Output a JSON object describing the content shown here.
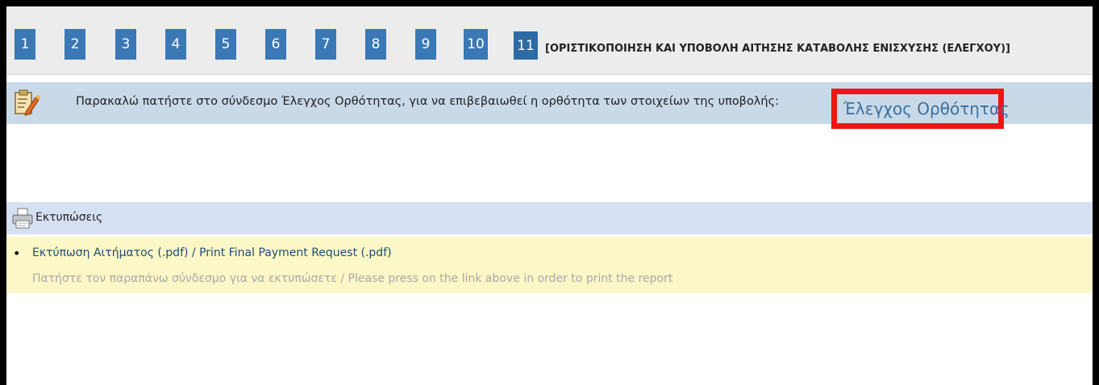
{
  "steps": [
    {
      "label": "1"
    },
    {
      "label": "2"
    },
    {
      "label": "3"
    },
    {
      "label": "4"
    },
    {
      "label": "5"
    },
    {
      "label": "6"
    },
    {
      "label": "7"
    },
    {
      "label": "8"
    },
    {
      "label": "9"
    },
    {
      "label": "10"
    },
    {
      "label": "11"
    }
  ],
  "step_title": "[ΟΡΙΣΤΙΚΟΠΟΙΗΣΗ ΚΑΙ ΥΠΟΒΟΛΗ ΑΙΤΗΣΗΣ ΚΑΤΑΒΟΛΗΣ ΕΝΙΣΧΥΣΗΣ (ΕΛΕΓΧΟΥ)]",
  "notice": {
    "icon": "clipboard-edit-icon",
    "text": "Παρακαλώ πατήστε στο σύνδεσμο Έλεγχος Ορθότητας, για να επιβεβαιωθεί η ορθότητα των στοιχείων της υποβολής:",
    "link_label": "Έλεγχος Ορθότητας"
  },
  "prints": {
    "icon": "printer-icon",
    "header": "Εκτυπώσεις",
    "items": [
      {
        "label": "Εκτύπωση Αιτήματος (.pdf) / Print Final Payment Request (.pdf)",
        "hint": "Πατήστε τον παραπάνω σύνδεσμο για να εκτυπώσετε / Please press on the link above in order to print the report"
      }
    ]
  },
  "colors": {
    "step_blue": "#3b78b6",
    "highlight_red": "#ee1515",
    "notice_bg": "#c9d9e8",
    "prints_header_bg": "#d5e0f2",
    "prints_list_bg": "#fbf7c6"
  }
}
